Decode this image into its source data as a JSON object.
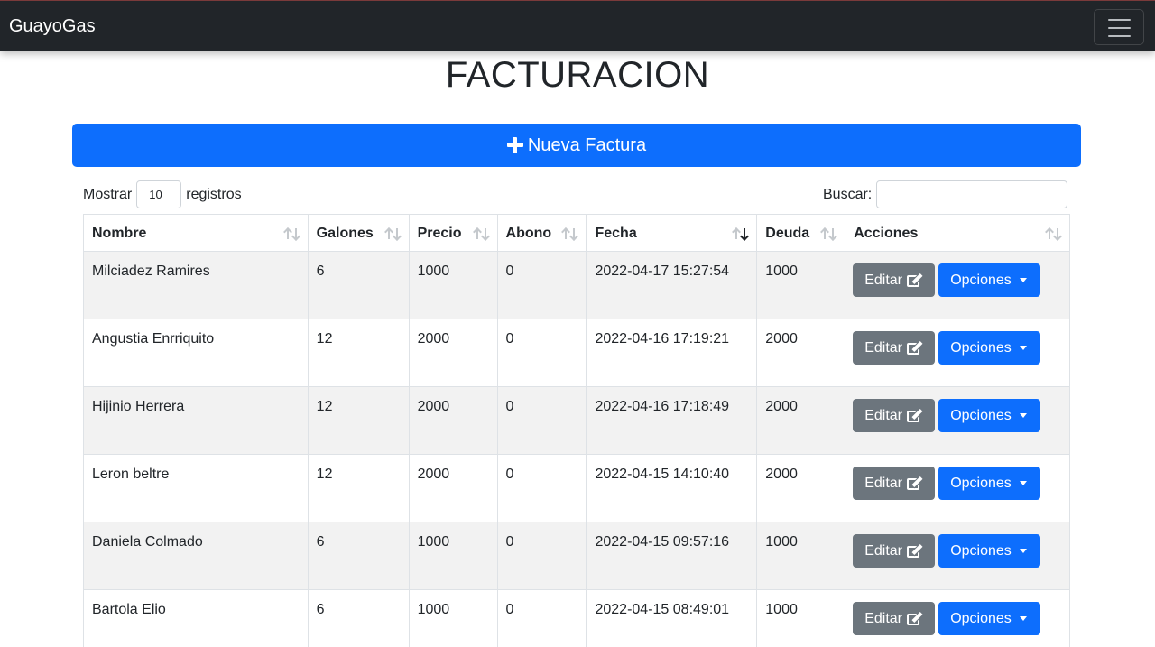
{
  "navbar": {
    "brand": "GuayoGas"
  },
  "page": {
    "title": "FACTURACION"
  },
  "new_button": {
    "label": "Nueva Factura"
  },
  "length_control": {
    "prefix": "Mostrar",
    "value": "10",
    "suffix": "registros"
  },
  "search": {
    "label": "Buscar:",
    "value": ""
  },
  "table": {
    "headers": [
      "Nombre",
      "Galones",
      "Precio",
      "Abono",
      "Fecha",
      "Deuda",
      "Acciones"
    ],
    "sorted_column": "Fecha",
    "sort_direction": "desc",
    "rows": [
      {
        "nombre": "Milciadez Ramires",
        "galones": "6",
        "precio": "1000",
        "abono": "0",
        "fecha": "2022-04-17 15:27:54",
        "deuda": "1000"
      },
      {
        "nombre": "Angustia Enrriquito",
        "galones": "12",
        "precio": "2000",
        "abono": "0",
        "fecha": "2022-04-16 17:19:21",
        "deuda": "2000"
      },
      {
        "nombre": "Hijinio Herrera",
        "galones": "12",
        "precio": "2000",
        "abono": "0",
        "fecha": "2022-04-16 17:18:49",
        "deuda": "2000"
      },
      {
        "nombre": "Leron beltre",
        "galones": "12",
        "precio": "2000",
        "abono": "0",
        "fecha": "2022-04-15 14:10:40",
        "deuda": "2000"
      },
      {
        "nombre": "Daniela Colmado",
        "galones": "6",
        "precio": "1000",
        "abono": "0",
        "fecha": "2022-04-15 09:57:16",
        "deuda": "1000"
      },
      {
        "nombre": "Bartola Elio",
        "galones": "6",
        "precio": "1000",
        "abono": "0",
        "fecha": "2022-04-15 08:49:01",
        "deuda": "1000"
      }
    ],
    "row_actions": {
      "edit_label": "Editar",
      "options_label": "Opciones"
    }
  },
  "icons": {
    "menu": "hamburger-menu-icon",
    "new": "plus-icon",
    "edit": "edit-square-icon",
    "options": "caret-down-icon",
    "sort": "sort-arrows-icon"
  },
  "colors": {
    "navbar": "#212529",
    "primary": "#0d6efd",
    "secondary": "#6c757d",
    "striped_row": "#f2f2f2"
  }
}
